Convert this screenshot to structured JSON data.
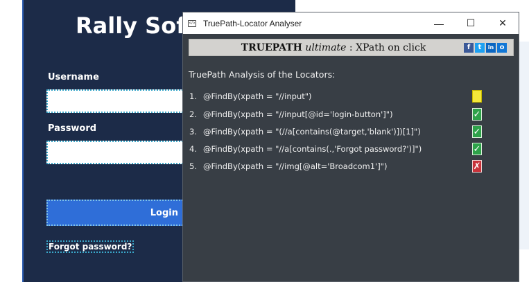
{
  "background_page": {
    "brand_title": "Rally Soft",
    "username_label": "Username",
    "password_label": "Password",
    "login_button": "Login",
    "forgot_link": "Forgot password?"
  },
  "window": {
    "title": "TruePath-Locator Analyser",
    "minimize": "—",
    "maximize": "☐",
    "close": "✕"
  },
  "banner": {
    "brand": "TRUEPATH",
    "edition": "ultimate",
    "tagline": ": XPath on click",
    "share_icons": [
      "facebook-icon",
      "twitter-icon",
      "linkedin-icon",
      "outlook-icon"
    ],
    "share_glyphs": [
      "f",
      "t",
      "in",
      "o"
    ]
  },
  "analysis": {
    "heading": "TruePath Analysis of the Locators:",
    "locators": [
      {
        "num": "1.",
        "text": "@FindBy(xpath = \"//input\")",
        "status": "warn",
        "glyph": "?"
      },
      {
        "num": "2.",
        "text": "@FindBy(xpath = \"//input[@id='login-button']\")",
        "status": "pass",
        "glyph": "✓"
      },
      {
        "num": "3.",
        "text": "@FindBy(xpath = \"(//a[contains(@target,'blank')])[1]\")",
        "status": "pass",
        "glyph": "✓"
      },
      {
        "num": "4.",
        "text": "@FindBy(xpath = \"//a[contains(.,'Forgot password?')]\")",
        "status": "pass",
        "glyph": "✓"
      },
      {
        "num": "5.",
        "text": "@FindBy(xpath = \"//img[@alt='Broadcom1']\")",
        "status": "fail",
        "glyph": "✗"
      }
    ]
  },
  "colors": {
    "page_bg": "#1c2b48",
    "window_bg": "#383e45",
    "login_button": "#2f6ed8",
    "pass": "#2ea24a",
    "fail": "#c8323a",
    "warn": "#f3e83a"
  }
}
